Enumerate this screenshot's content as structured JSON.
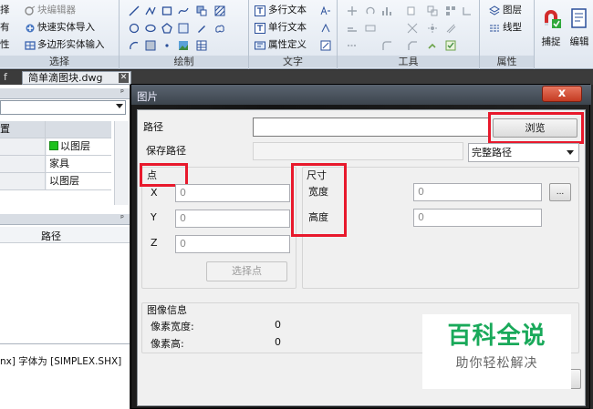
{
  "ribbon": {
    "col1": [
      "择",
      "有",
      "性"
    ],
    "col2": [
      "块编辑器",
      "快速实体导入",
      "多边形实体输入"
    ],
    "panels": {
      "select": "选择",
      "draw": "绘制",
      "text": "文字",
      "tools": "工具",
      "properties": "属性"
    },
    "text_items": [
      "多行文本",
      "单行文本",
      "属性定义"
    ],
    "prop_items": [
      "图层",
      "线型"
    ],
    "big_buttons": [
      "捕捉",
      "编辑"
    ]
  },
  "tabs": {
    "left_fragment": "f",
    "active": "简单滴图块.dwg"
  },
  "properties_panel": {
    "header_fragment": "置",
    "rows": [
      {
        "left": "",
        "right": "以图层",
        "green": true
      },
      {
        "left": "",
        "right": "家具",
        "green": false
      },
      {
        "left": "",
        "right": "以图层",
        "green": false
      }
    ],
    "path_column": "路径"
  },
  "command_line": {
    "text": "nx] 字体为 [SIMPLEX.SHX]"
  },
  "dialog": {
    "title": "图片",
    "close_label": "x",
    "path_label": "路径",
    "path_value": "",
    "browse_label": "浏览",
    "save_path_label": "保存路径",
    "save_path_value": "",
    "save_path_mode": "完整路径",
    "point_group": "点",
    "x_label": "X",
    "y_label": "Y",
    "z_label": "Z",
    "x_value": "0",
    "y_value": "0",
    "z_value": "0",
    "pick_point_label": "选择点",
    "size_group": "尺寸",
    "width_label": "宽度",
    "height_label": "高度",
    "width_value": "0",
    "height_value": "0",
    "ellipsis_label": "...",
    "info_group": "图像信息",
    "pixel_width_label": "像素宽度:",
    "pixel_height_label": "像素高:",
    "pixel_width_value": "0",
    "pixel_height_value": "0"
  },
  "watermark": {
    "main": "百科全说",
    "sub": "助你轻松解决"
  },
  "colors": {
    "highlight": "#e8192c",
    "watermark_green": "#19a95a",
    "layer_green": "#1ec11e"
  }
}
